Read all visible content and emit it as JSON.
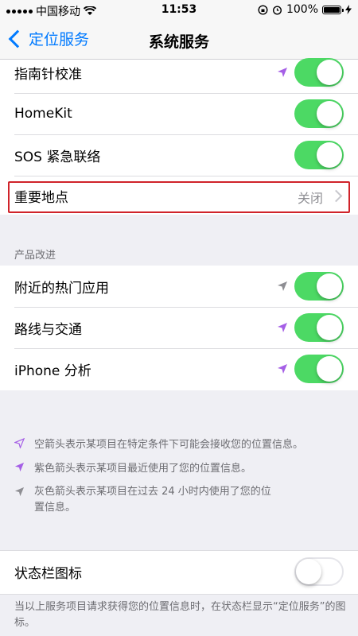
{
  "status_bar": {
    "carrier": "中国移动",
    "time": "11:53",
    "battery_percent": "100%",
    "battery_level": 1.0
  },
  "nav": {
    "back_label": "定位服务",
    "title": "系统服务"
  },
  "rows_top": [
    {
      "label": "指南针校准",
      "arrow": "purple",
      "toggle": true
    },
    {
      "label": "HomeKit",
      "toggle": true
    },
    {
      "label": "SOS 紧急联络",
      "toggle": true
    },
    {
      "label": "重要地点",
      "value": "关闭"
    }
  ],
  "section_product": {
    "header": "产品改进",
    "rows": [
      {
        "label": "附近的热门应用",
        "arrow": "gray",
        "toggle": true
      },
      {
        "label": "路线与交通",
        "arrow": "purple",
        "toggle": true
      },
      {
        "label": "iPhone 分析",
        "arrow": "purple",
        "toggle": true
      }
    ]
  },
  "legend": [
    {
      "icon": "hollow-arrow-icon",
      "text": "空箭头表示某项目在特定条件下可能会接收您的位置信息。"
    },
    {
      "icon": "purple-arrow-icon",
      "text": "紫色箭头表示某项目最近使用了您的位置信息。"
    },
    {
      "icon": "gray-arrow-icon",
      "text": "灰色箭头表示某项目在过去 24 小时内使用了您的位置信息。"
    }
  ],
  "status_icon_row": {
    "label": "状态栏图标",
    "toggle": false
  },
  "footer_note": "当以上服务项目请求获得您的位置信息时，在状态栏显示“定位服务”的图标。",
  "colors": {
    "accent": "#007aff",
    "toggle_on": "#4cd964",
    "purple_arrow": "#a55fe6",
    "gray_arrow": "#8e8e93",
    "highlight": "#d0232a"
  }
}
